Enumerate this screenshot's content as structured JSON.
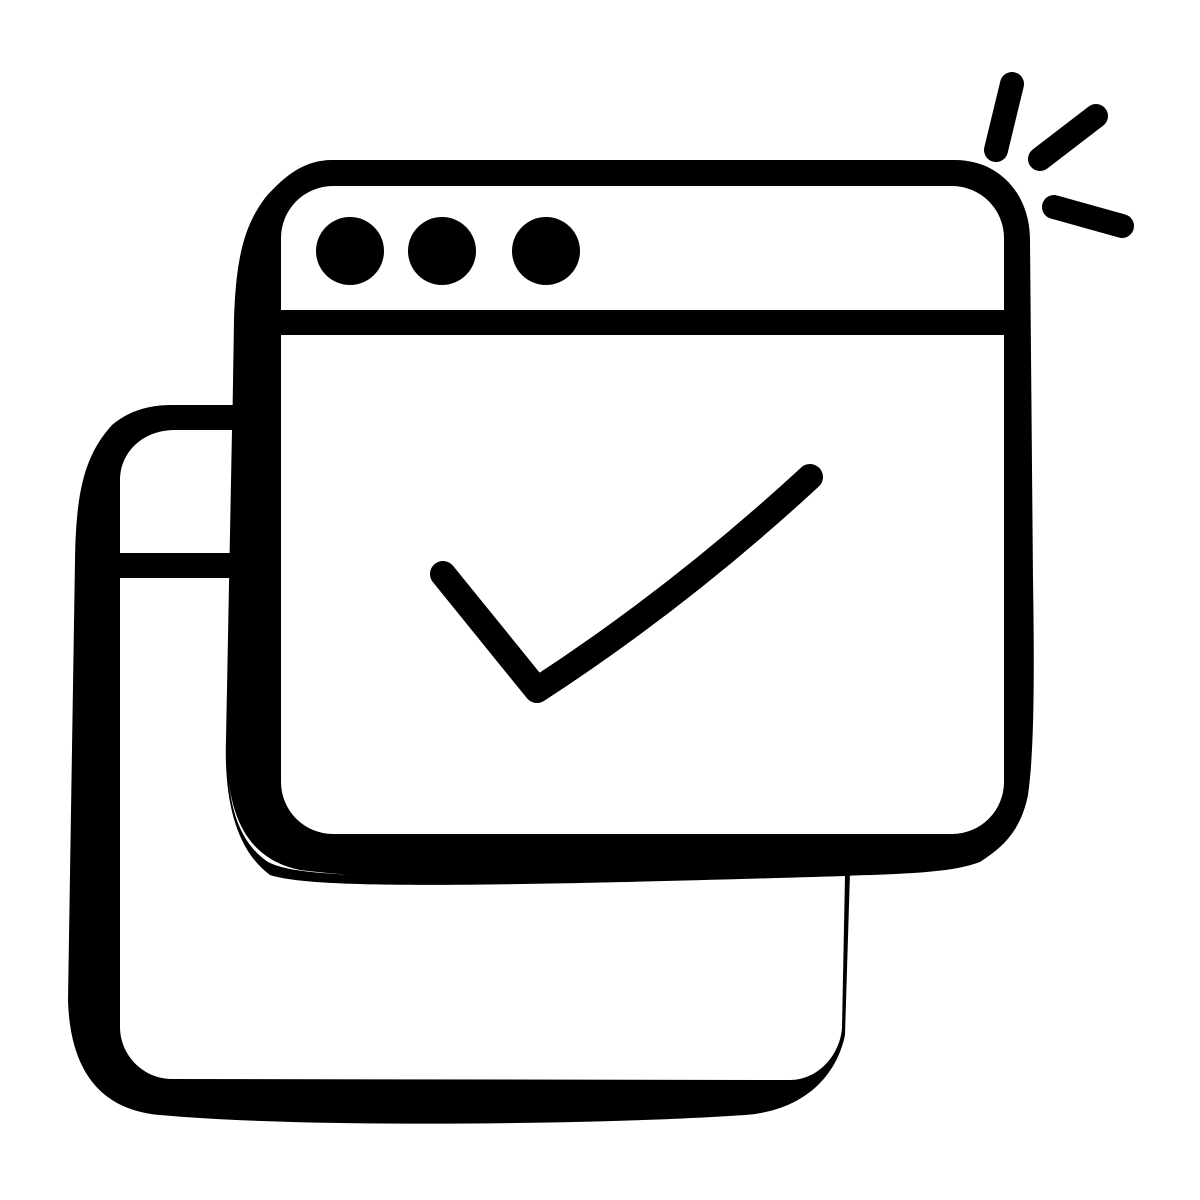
{
  "icon": {
    "name": "browser-windows-check-icon",
    "stroke_color": "#000000",
    "fill_color": "#ffffff"
  }
}
